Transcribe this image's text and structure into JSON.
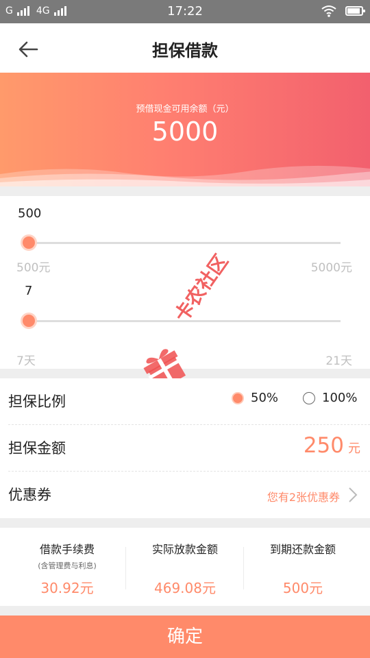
{
  "status_bar": {
    "carrier_1": "G",
    "carrier_2": "4G",
    "time": "17:22",
    "icons": [
      "signal-icon",
      "signal-icon",
      "wifi-icon",
      "battery-charging-icon"
    ]
  },
  "nav": {
    "title": "担保借款",
    "back_icon": "back-arrow-icon"
  },
  "banner": {
    "label": "预借现金可用余额（元）",
    "amount": "5000"
  },
  "amount_slider": {
    "value": "500",
    "min_label": "500元",
    "max_label": "5000元",
    "fraction": 0.0
  },
  "days_slider": {
    "value": "7",
    "min_label": "7天",
    "max_label": "21天",
    "fraction": 0.0
  },
  "guarantee_ratio": {
    "label": "担保比例",
    "options": [
      {
        "label": "50%",
        "selected": true
      },
      {
        "label": "100%",
        "selected": false
      }
    ]
  },
  "guarantee_amount": {
    "label": "担保金额",
    "value": "250",
    "unit": "元"
  },
  "coupon": {
    "label": "优惠券",
    "text": "您有2张优惠券",
    "icon": "chevron-right-icon"
  },
  "summary": {
    "columns": [
      {
        "title": "借款手续费",
        "sub": "(含管理费与利息)",
        "value": "30.92元"
      },
      {
        "title": "实际放款金额",
        "value": "469.08元"
      },
      {
        "title": "到期还款金额",
        "value": "500元"
      }
    ]
  },
  "confirm_button": "确定",
  "watermark": {
    "text": "卡农社区",
    "icon": "gift-box-logo-icon"
  },
  "colors": {
    "accent": "#ff8a6a",
    "banner_start": "#ff9a6b",
    "banner_end": "#f2606e",
    "status_bar": "#7a7a7a"
  }
}
